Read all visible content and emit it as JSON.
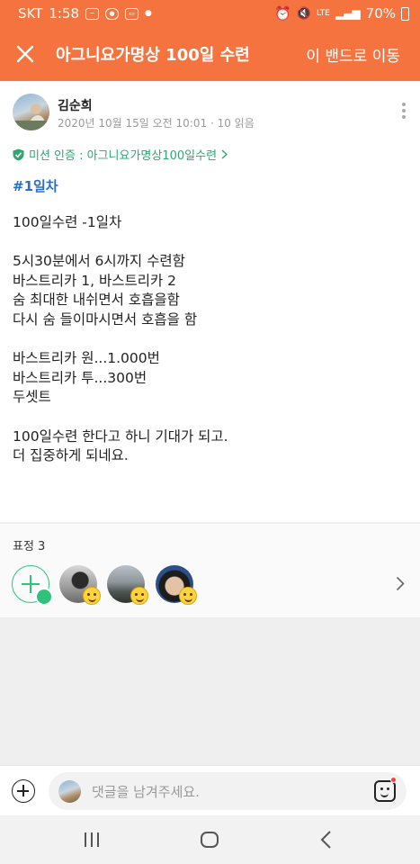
{
  "status_bar": {
    "carrier": "SKT",
    "time": "1:58",
    "battery": "70%",
    "network": "LTE"
  },
  "app_bar": {
    "title": "아그니요가명상 100일 수련",
    "move_label": "이 밴드로 이동"
  },
  "post": {
    "author": "김순희",
    "date": "2020년 10월 15일 오전 10:01",
    "read_count": "10 읽음",
    "mission": "미션 인증 : 아그니요가명상100일수련",
    "hashtag": "#1일차",
    "lines": [
      "100일수련 -1일차",
      "",
      "5시30분에서 6시까지 수련함",
      "바스트리카 1, 바스트리카 2",
      "숨 최대한 내쉬면서 호흡을함",
      "다시 숨 들이마시면서 호흡을 함",
      "",
      "바스트리카  원...1.000번",
      "바스트리카  투...300번",
      "두셋트",
      "",
      "100일수련 한다고 하니 기대가 되고.",
      "더 집중하게 되네요."
    ]
  },
  "reactions": {
    "label": "표정 3",
    "count": 3
  },
  "comment": {
    "placeholder": "댓글을 남겨주세요."
  },
  "colors": {
    "accent": "#f4733f",
    "mission_green": "#2fa56f",
    "hashtag_blue": "#2b6fc2"
  }
}
